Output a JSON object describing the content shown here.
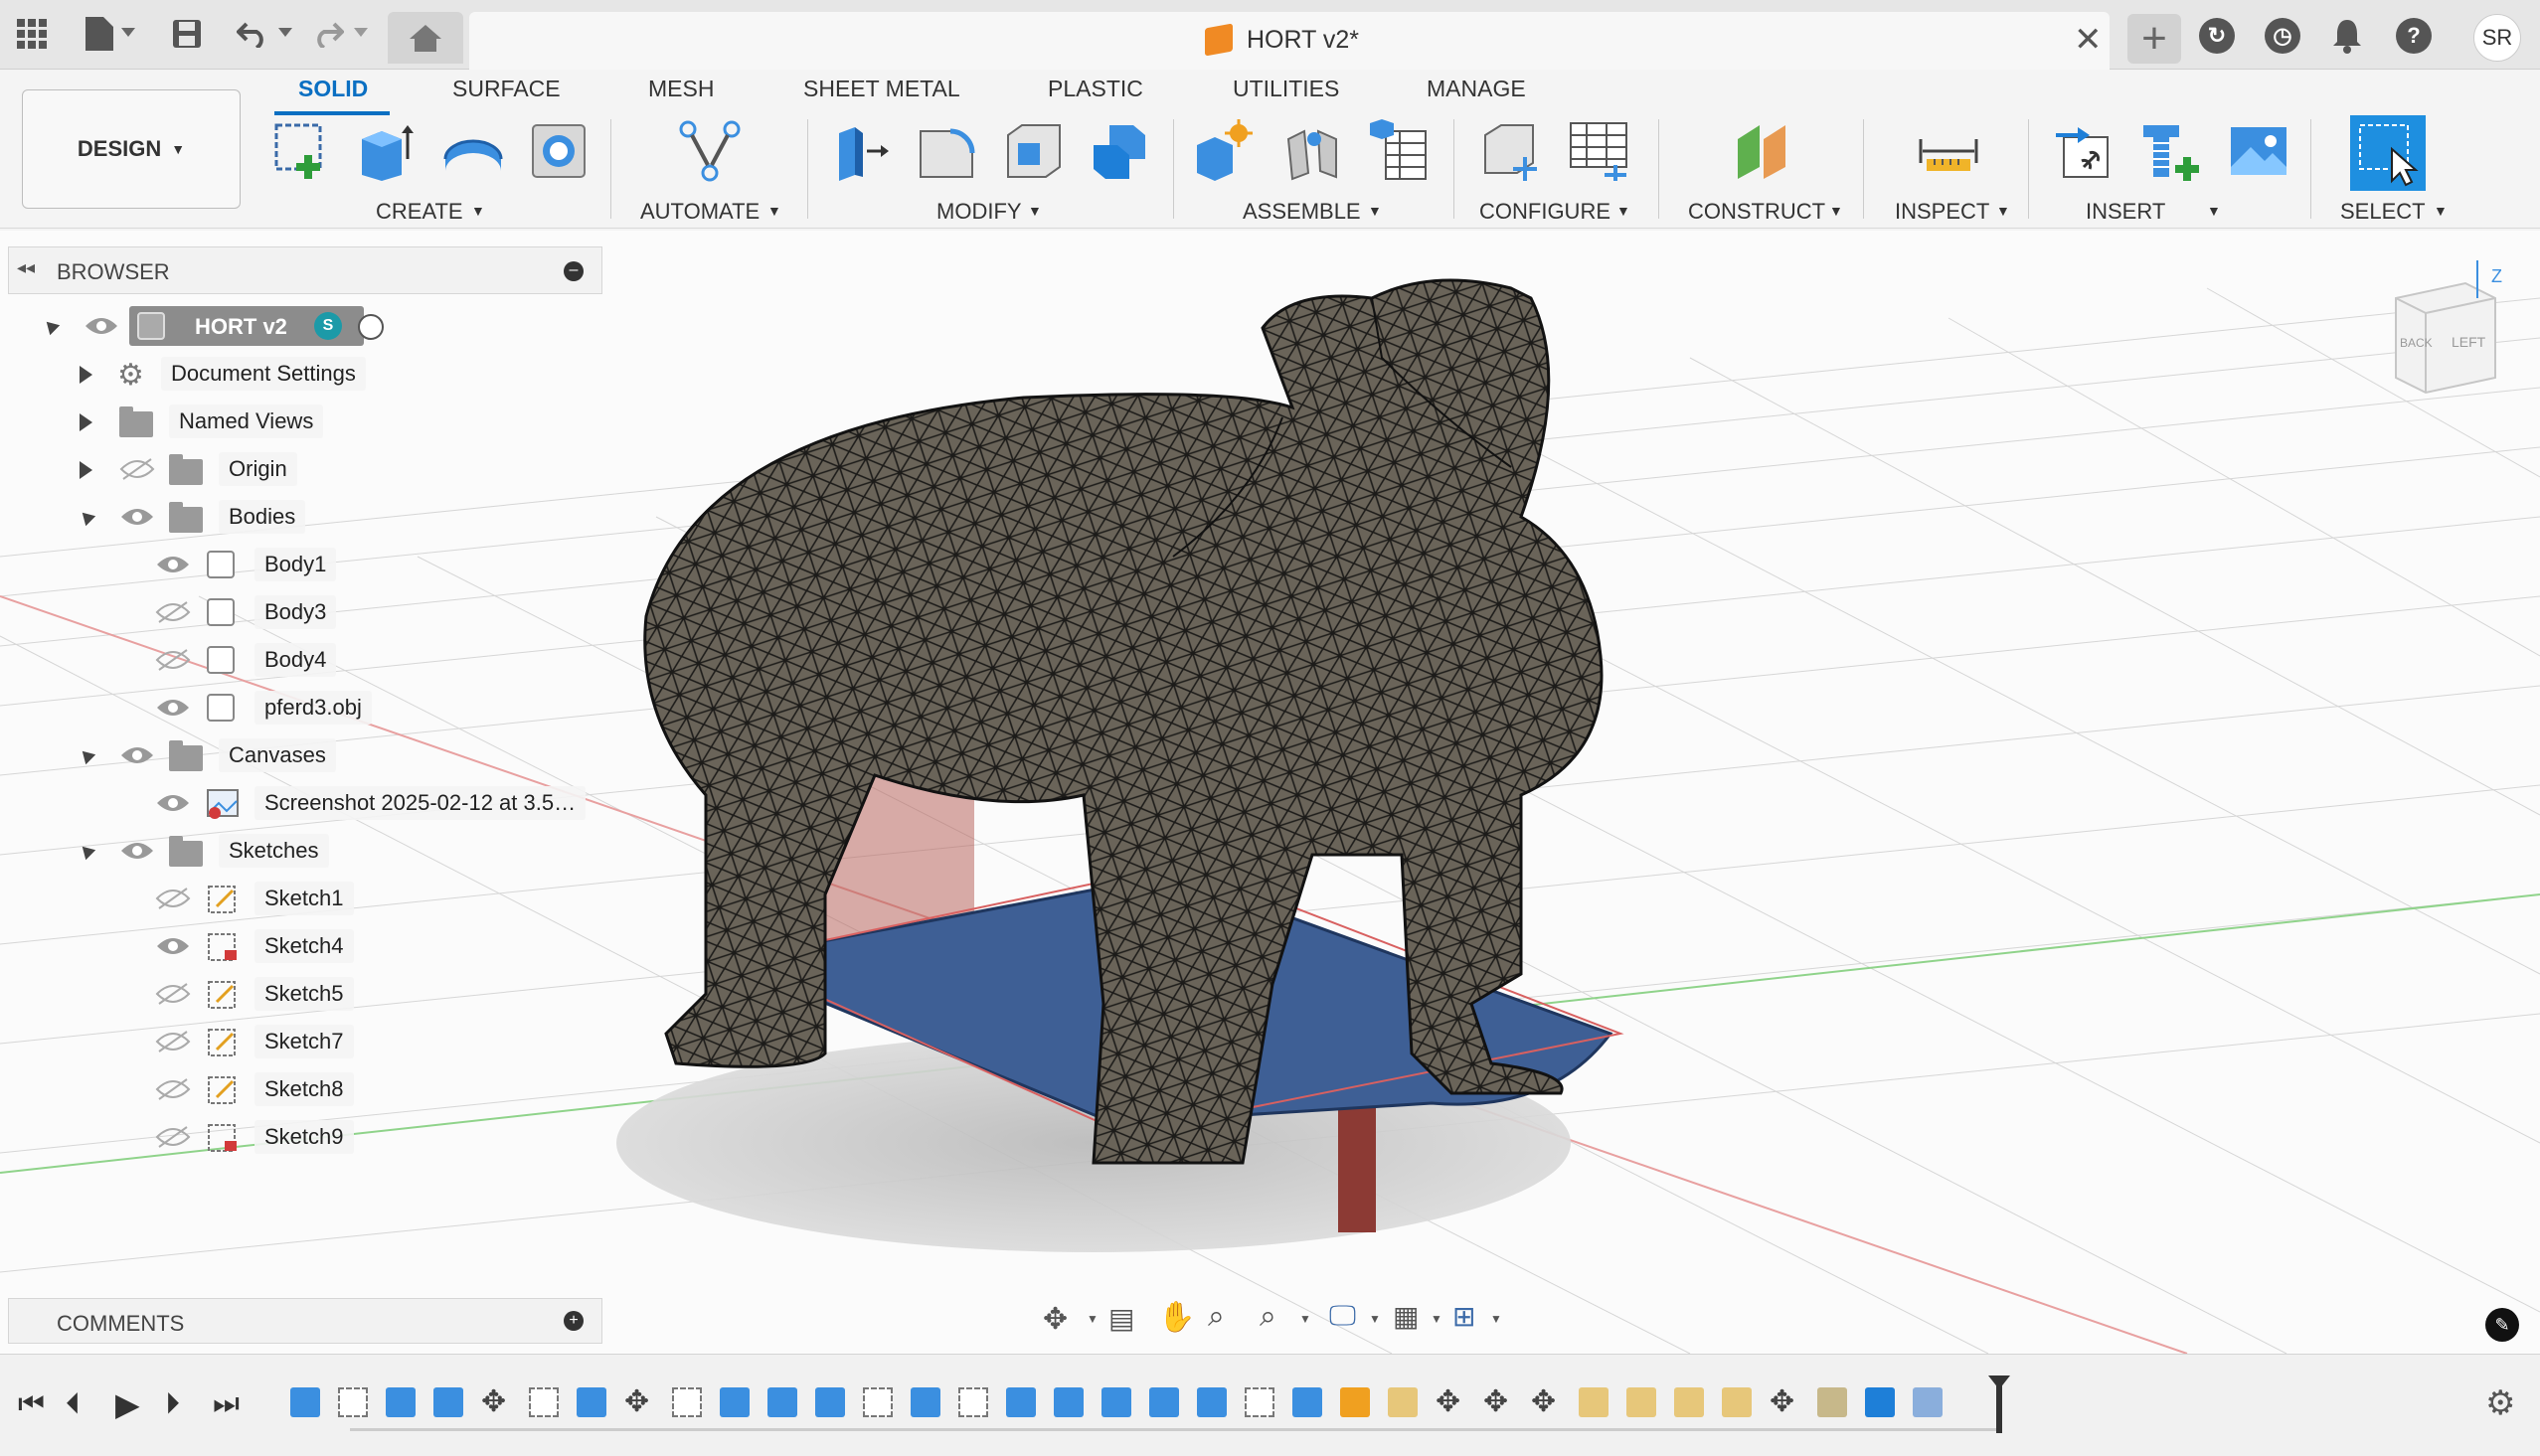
{
  "app": {
    "document_title": "HORT v2*",
    "user_initials": "SR"
  },
  "ribbon": {
    "workspace": "DESIGN",
    "tabs": [
      {
        "label": "SOLID",
        "active": true
      },
      {
        "label": "SURFACE"
      },
      {
        "label": "MESH"
      },
      {
        "label": "SHEET METAL"
      },
      {
        "label": "PLASTIC"
      },
      {
        "label": "UTILITIES"
      },
      {
        "label": "MANAGE"
      }
    ],
    "groups": [
      "CREATE",
      "AUTOMATE",
      "MODIFY",
      "ASSEMBLE",
      "CONFIGURE",
      "CONSTRUCT",
      "INSPECT",
      "INSERT",
      "SELECT"
    ]
  },
  "browser": {
    "title": "BROWSER",
    "root": "HORT v2",
    "items": [
      {
        "label": "Document Settings",
        "icon": "gear-icon"
      },
      {
        "label": "Named Views",
        "icon": "folder-icon"
      },
      {
        "label": "Origin",
        "icon": "folder-icon"
      },
      {
        "label": "Bodies",
        "icon": "folder-icon"
      },
      {
        "label": "Body1",
        "icon": "body-icon"
      },
      {
        "label": "Body3",
        "icon": "body-icon"
      },
      {
        "label": "Body4",
        "icon": "body-icon"
      },
      {
        "label": "pferd3.obj",
        "icon": "body-icon"
      },
      {
        "label": "Canvases",
        "icon": "folder-icon"
      },
      {
        "label": "Screenshot 2025-02-12 at 3.5…",
        "icon": "canvas-icon"
      },
      {
        "label": "Sketches",
        "icon": "folder-icon"
      },
      {
        "label": "Sketch1",
        "icon": "sketch-icon"
      },
      {
        "label": "Sketch4",
        "icon": "sketch-icon"
      },
      {
        "label": "Sketch5",
        "icon": "sketch-icon"
      },
      {
        "label": "Sketch7",
        "icon": "sketch-icon"
      },
      {
        "label": "Sketch8",
        "icon": "sketch-icon"
      },
      {
        "label": "Sketch9",
        "icon": "sketch-icon"
      }
    ]
  },
  "comments": {
    "title": "COMMENTS"
  },
  "viewcube": {
    "top_axis": "Z",
    "faces": [
      "BACK",
      "LEFT"
    ]
  },
  "colors": {
    "accent": "#0a6fc2",
    "mesh": "#5b5750",
    "pcb": "#3e5f95",
    "rod": "#8c3a34"
  }
}
